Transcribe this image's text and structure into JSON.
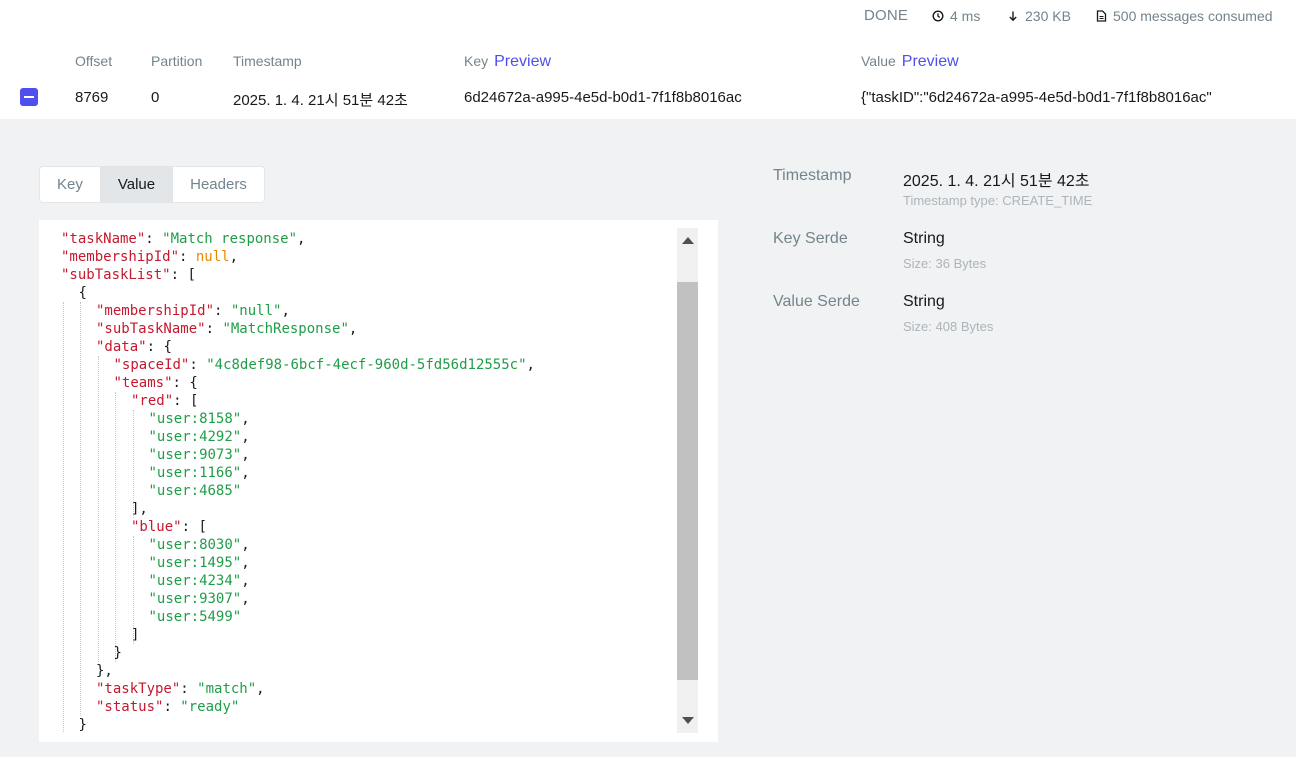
{
  "status": {
    "state": "DONE",
    "elapsed": "4 ms",
    "bytes": "230 KB",
    "messages": "500 messages consumed"
  },
  "table": {
    "headers": {
      "offset": "Offset",
      "partition": "Partition",
      "timestamp": "Timestamp",
      "key": "Key",
      "value": "Value",
      "preview": "Preview"
    },
    "row": {
      "offset": "8769",
      "partition": "0",
      "timestamp": "2025. 1. 4. 21시 51분 42초",
      "key": "6d24672a-a995-4e5d-b0d1-7f1f8b8016ac",
      "value": "{\"taskID\":\"6d24672a-a995-4e5d-b0d1-7f1f8b8016ac\""
    }
  },
  "detail": {
    "tabs": [
      "Key",
      "Value",
      "Headers"
    ],
    "active_tab": "Value",
    "json_lines": [
      {
        "key": "taskName",
        "val": "\"Match response\"",
        "vt": "s",
        "trail": ","
      },
      {
        "key": "membershipId",
        "val": "null",
        "vt": "n",
        "trail": ","
      },
      {
        "key": "subTaskList",
        "val": "[",
        "vt": "p",
        "trail": ""
      },
      {
        "text": "{"
      },
      {
        "key": "membershipId",
        "val": "\"null\"",
        "vt": "s",
        "trail": ","
      },
      {
        "key": "subTaskName",
        "val": "\"MatchResponse\"",
        "vt": "s",
        "trail": ","
      },
      {
        "key": "data",
        "val": "{",
        "vt": "p",
        "trail": ""
      },
      {
        "key": "spaceId",
        "val": "\"4c8def98-6bcf-4ecf-960d-5fd56d12555c\"",
        "vt": "s",
        "trail": ","
      },
      {
        "key": "teams",
        "val": "{",
        "vt": "p",
        "trail": ""
      },
      {
        "key": "red",
        "val": "[",
        "vt": "p",
        "trail": ""
      },
      {
        "str": "\"user:8158\"",
        "trail": ","
      },
      {
        "str": "\"user:4292\"",
        "trail": ","
      },
      {
        "str": "\"user:9073\"",
        "trail": ","
      },
      {
        "str": "\"user:1166\"",
        "trail": ","
      },
      {
        "str": "\"user:4685\"",
        "trail": ""
      },
      {
        "text": "],"
      },
      {
        "key": "blue",
        "val": "[",
        "vt": "p",
        "trail": ""
      },
      {
        "str": "\"user:8030\"",
        "trail": ","
      },
      {
        "str": "\"user:1495\"",
        "trail": ","
      },
      {
        "str": "\"user:4234\"",
        "trail": ","
      },
      {
        "str": "\"user:9307\"",
        "trail": ","
      },
      {
        "str": "\"user:5499\"",
        "trail": ""
      },
      {
        "text": "]"
      },
      {
        "text": "}"
      },
      {
        "text": "},"
      },
      {
        "key": "taskType",
        "val": "\"match\"",
        "vt": "s",
        "trail": ","
      },
      {
        "key": "status",
        "val": "\"ready\"",
        "vt": "s",
        "trail": ""
      },
      {
        "text": "}"
      }
    ],
    "meta": {
      "timestamp_label": "Timestamp",
      "timestamp_value": "2025. 1. 4. 21시 51분 42초",
      "timestamp_type": "Timestamp type: CREATE_TIME",
      "key_serde_label": "Key Serde",
      "key_serde_value": "String",
      "key_size": "Size: 36 Bytes",
      "value_serde_label": "Value Serde",
      "value_serde_value": "String",
      "value_size": "Size: 408 Bytes"
    }
  },
  "colors": {
    "accent": "#4f4ff0",
    "json_key": "#c4192e",
    "json_string": "#1f9e48",
    "json_null": "#e88a00"
  },
  "icons": [
    "clock-icon",
    "arrow-down-icon",
    "file-icon",
    "collapse-icon",
    "scroll-up-icon",
    "scroll-down-icon"
  ]
}
